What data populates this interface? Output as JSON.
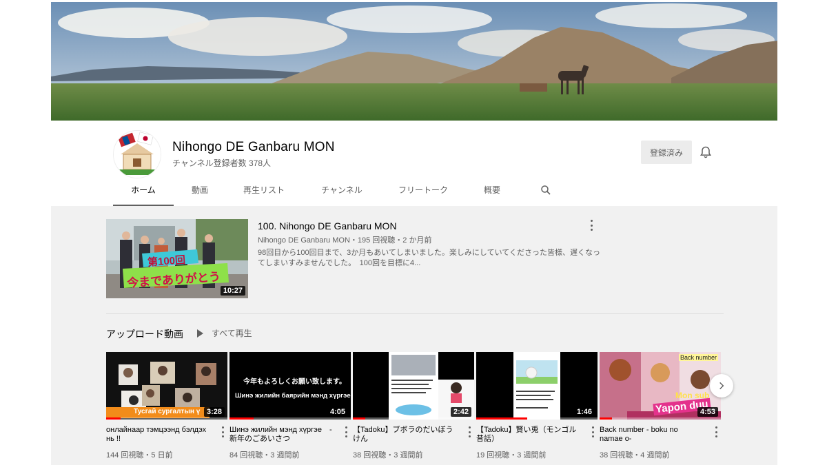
{
  "channel": {
    "name": "Nihongo DE Ganbaru MON",
    "subscribers": "チャンネル登録者数 378人",
    "subscribe_label": "登録済み"
  },
  "tabs": [
    {
      "label": "ホーム"
    },
    {
      "label": "動画"
    },
    {
      "label": "再生リスト"
    },
    {
      "label": "チャンネル"
    },
    {
      "label": "フリートーク"
    },
    {
      "label": "概要"
    }
  ],
  "featured": {
    "title": "100. Nihongo DE Ganbaru MON",
    "meta": "Nihongo DE Ganbaru MON・195 回視聴・2 か月前",
    "description": "98回目から100回目まで、3か月もあいてしまいました。楽しみにしていてくださった皆様、遅くなってしまいすみませんでした。　100回を目標に4...",
    "duration": "10:27",
    "sign_line1": "第100回",
    "sign_line2": "今までありがとう"
  },
  "uploads": {
    "section_title": "アップロード動画",
    "play_all_label": "すべて再生",
    "videos": [
      {
        "title": "онлайнаар тэмцээнд бэлдэх нь !!",
        "meta": "144 回視聴・5 日前",
        "duration": "3:28",
        "progress": 0.12,
        "caption": "Тусгай сургалтын ү"
      },
      {
        "title": "Шинэ жилийн мэнд хүргэе　-新年のごあいさつ",
        "meta": "84 回視聴・3 週間前",
        "duration": "4:05",
        "progress": 0.2,
        "caption_jp": "今年もよろしくお願い致します。",
        "caption_mn": "Шинэ жилийн баярийн мэнд хүргэе."
      },
      {
        "title": "【Tadoku】ブボラのだいぼうけん",
        "meta": "38 回視聴・3 週間前",
        "duration": "2:42",
        "progress": 0.1
      },
      {
        "title": "【Tadoku】賢い兎（モンゴル昔話）",
        "meta": "19 回視聴・3 週間前",
        "duration": "1:46",
        "progress": 0.42
      },
      {
        "title": "Back number - boku no namae o-",
        "meta": "38 回視聴・4 週間前",
        "duration": "4:53",
        "progress": 0.1,
        "caption_top": "Back number",
        "caption_mid": "Mon sub",
        "caption_bottom": "Yapon duu"
      }
    ]
  },
  "colors": {
    "accent": "#ff0000",
    "text_secondary": "#606060",
    "background": "#f1f1f1"
  }
}
